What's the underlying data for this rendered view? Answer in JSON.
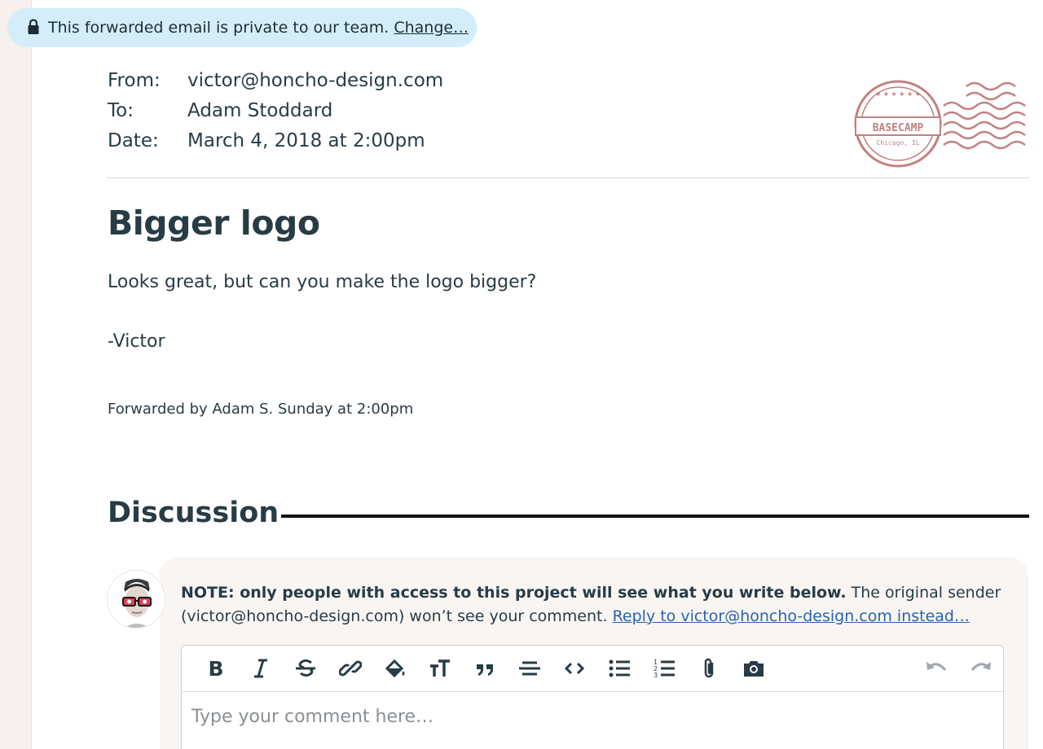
{
  "privacy": {
    "text": "This forwarded email is private to our team.",
    "change_label": "Change…"
  },
  "email": {
    "from_label": "From:",
    "from_value": "victor@honcho-design.com",
    "to_label": "To:",
    "to_value": "Adam Stoddard",
    "date_label": "Date:",
    "date_value": "March 4, 2018 at 2:00pm"
  },
  "stamp": {
    "brand": "BASECAMP",
    "city": "Chicago, IL"
  },
  "message": {
    "title": "Bigger logo",
    "body": "Looks great, but can you make the logo bigger?",
    "signature": "-Victor",
    "forwarded": "Forwarded by Adam S. Sunday at 2:00pm"
  },
  "discussion": {
    "heading": "Discussion",
    "note_bold": "NOTE: only people with access to this project will see what you write below.",
    "note_text": " The original sender (victor@honcho-design.com) won’t see your comment. ",
    "reply_link": "Reply to victor@honcho-design.com instead…",
    "placeholder": "Type your comment here…"
  },
  "toolbar": {
    "buttons": [
      "bold-icon",
      "italic-icon",
      "strikethrough-icon",
      "link-icon",
      "paint-bucket-icon",
      "text-size-icon",
      "quote-icon",
      "divider-icon",
      "code-icon",
      "bulleted-list-icon",
      "numbered-list-icon",
      "attachment-icon",
      "camera-icon"
    ],
    "history": [
      "undo-icon",
      "redo-icon"
    ]
  },
  "colors": {
    "privacy_pill": "#d3eefa",
    "link": "#2763b4",
    "heading": "#283c46",
    "stamp": "#b96a6a"
  }
}
